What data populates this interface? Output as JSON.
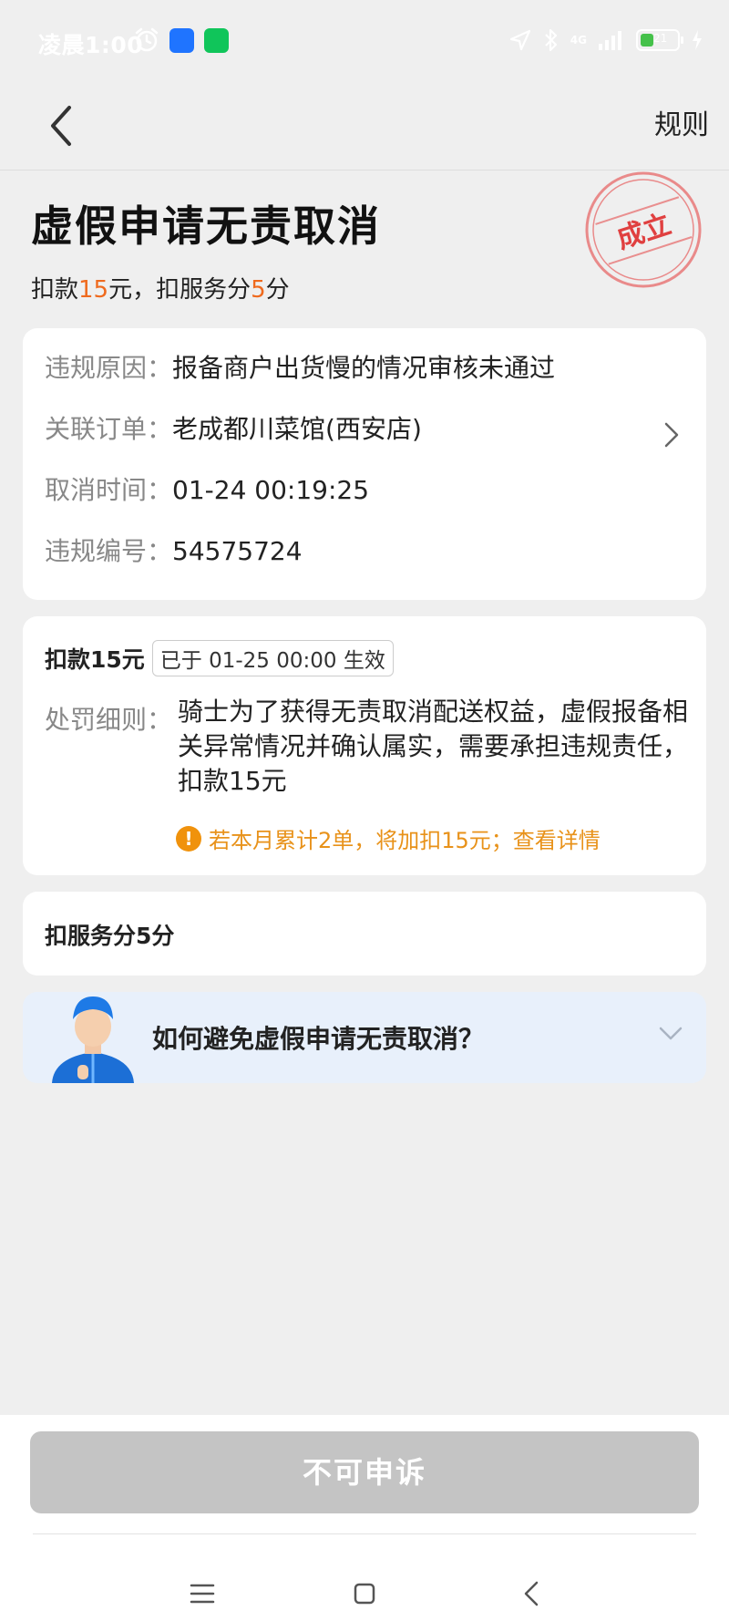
{
  "status_bar": {
    "time": "凌晨1:00",
    "app1_glyph": "",
    "app2_glyph": "",
    "signal": "4G",
    "battery": "21"
  },
  "nav": {
    "rules_label": "规则"
  },
  "hero": {
    "title": "虚假申请无责取消",
    "sub_prefix": "扣款",
    "sub_amount": "15",
    "sub_mid": "元，扣服务分",
    "sub_score": "5",
    "sub_suffix": "分",
    "stamp_text": "成立"
  },
  "info": [
    {
      "label": "违规原因：",
      "value": "报备商户出货慢的情况审核未通过"
    },
    {
      "label": "关联订单：",
      "value": "老成都川菜馆(西安店)"
    },
    {
      "label": "取消时间：",
      "value": "01-24 00:19:25"
    },
    {
      "label": "违规编号：",
      "value": "54575724"
    }
  ],
  "fine": {
    "title": "扣款15元",
    "badge": "已于 01-25 00:00 生效",
    "detail_label": "处罚细则：",
    "detail_text": "骑士为了获得无责取消配送权益，虚假报备相关异常情况并确认属实，需要承担违规责任，扣款15元",
    "warning_icon": "!",
    "warning_text": "若本月累计2单，将加扣15元；查看详情"
  },
  "score": {
    "text": "扣服务分5分"
  },
  "faq": {
    "question": "如何避免虚假申请无责取消？"
  },
  "footer": {
    "appeal_label": "不可申诉"
  },
  "colors": {
    "highlight": "#ef6a1e",
    "warning": "#e8921a",
    "stamp": "#e04040",
    "faq_bg": "#e8f0fb"
  }
}
